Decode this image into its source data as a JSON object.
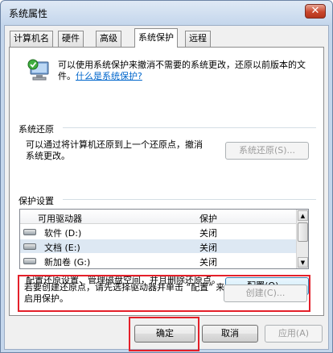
{
  "window": {
    "title": "系统属性",
    "close_glyph": "✕"
  },
  "tabs": [
    {
      "label": "计算机名",
      "active": false
    },
    {
      "label": "硬件",
      "active": false
    },
    {
      "label": "高级",
      "active": false
    },
    {
      "label": "系统保护",
      "active": true
    },
    {
      "label": "远程",
      "active": false
    }
  ],
  "intro": {
    "text": "可以使用系统保护来撤消不需要的系统更改，还原以前版本的文件。",
    "link": "什么是系统保护?"
  },
  "restore": {
    "group_title": "系统还原",
    "description": "可以通过将计算机还原到上一个还原点，撤消系统更改。",
    "button": "系统还原(S)..."
  },
  "protection": {
    "group_title": "保护设置",
    "columns": [
      "可用驱动器",
      "保护"
    ],
    "rows": [
      {
        "drive": "软件 (D:)",
        "status": "关闭",
        "selected": false
      },
      {
        "drive": "文档 (E:)",
        "status": "关闭",
        "selected": true
      },
      {
        "drive": "新加卷 (G:)",
        "status": "关闭",
        "selected": false
      }
    ],
    "configure_text": "配置还原设置、管理磁盘空间，并且删除还原点。",
    "configure_button": "配置(O)...",
    "create_text": "若要创建还原点，请先选择驱动器并单击 “配置” 来启用保护。",
    "create_button": "创建(C)..."
  },
  "footer": {
    "ok": "确定",
    "cancel": "取消",
    "apply": "应用(A)"
  },
  "colors": {
    "highlight_box": "#e4202a",
    "link": "#0066cc"
  }
}
